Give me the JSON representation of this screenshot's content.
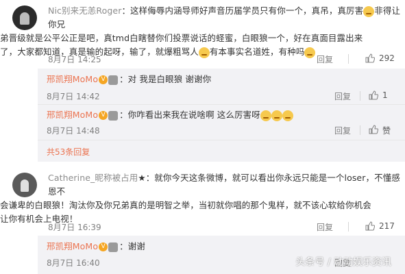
{
  "comments": [
    {
      "author": "Nic别来无恙Roger",
      "text_line1": "：这样侮辱内涵导师好声音历届学员只有你一个，真吊，真厉害",
      "text_line1b": "非得让你兄",
      "text_line2": "弟晋级就是公平公正是吧，真tmd白瞎替你们投票说话的蛏蜜，白眼狼一个，好在真面目露出来",
      "text_line3": "了，大家都知道，真是输的起呀，输了，就爆粗骂人",
      "text_line3b": "有本事实名道姓，有种吗",
      "time": "8月7日 14:25",
      "reply_label": "回复",
      "likes": "292"
    },
    {
      "author": "Catherine_昵称被占用",
      "text_line1": "：就你今天这条微博，就可以看出你永远只能是一个loser，不懂感恩不",
      "text_line2": "会谦卑的白眼狼！淘汰你及你兄弟真的是明智之举，当初就你唱的那个鬼样，就不该心软给你机会",
      "text_line3": "让你有机会上电视！",
      "time": "8月7日 16:39",
      "reply_label": "回复",
      "likes": "217"
    }
  ],
  "replies": [
    {
      "author": "邢凯翔MoMo",
      "text": "：对 我是白眼狼 谢谢你",
      "time": "8月7日 14:42",
      "reply_label": "回复",
      "likes": "1"
    },
    {
      "author": "邢凯翔MoMo",
      "text": "：你咋看出来我在说啥啊 这么厉害呀",
      "time": "8月7日 14:48",
      "reply_label": "回复",
      "likes": "赞"
    },
    {
      "author": "邢凯翔MoMo",
      "text": "：谢谢",
      "time": "8月7日 16:40",
      "reply_label": "回复"
    }
  ],
  "more_replies": "共53条回复",
  "watermark": "头条号 / 动动娱乐资讯",
  "colors": {
    "link": "#eb7350",
    "reply_bg": "#f2f2f5"
  }
}
